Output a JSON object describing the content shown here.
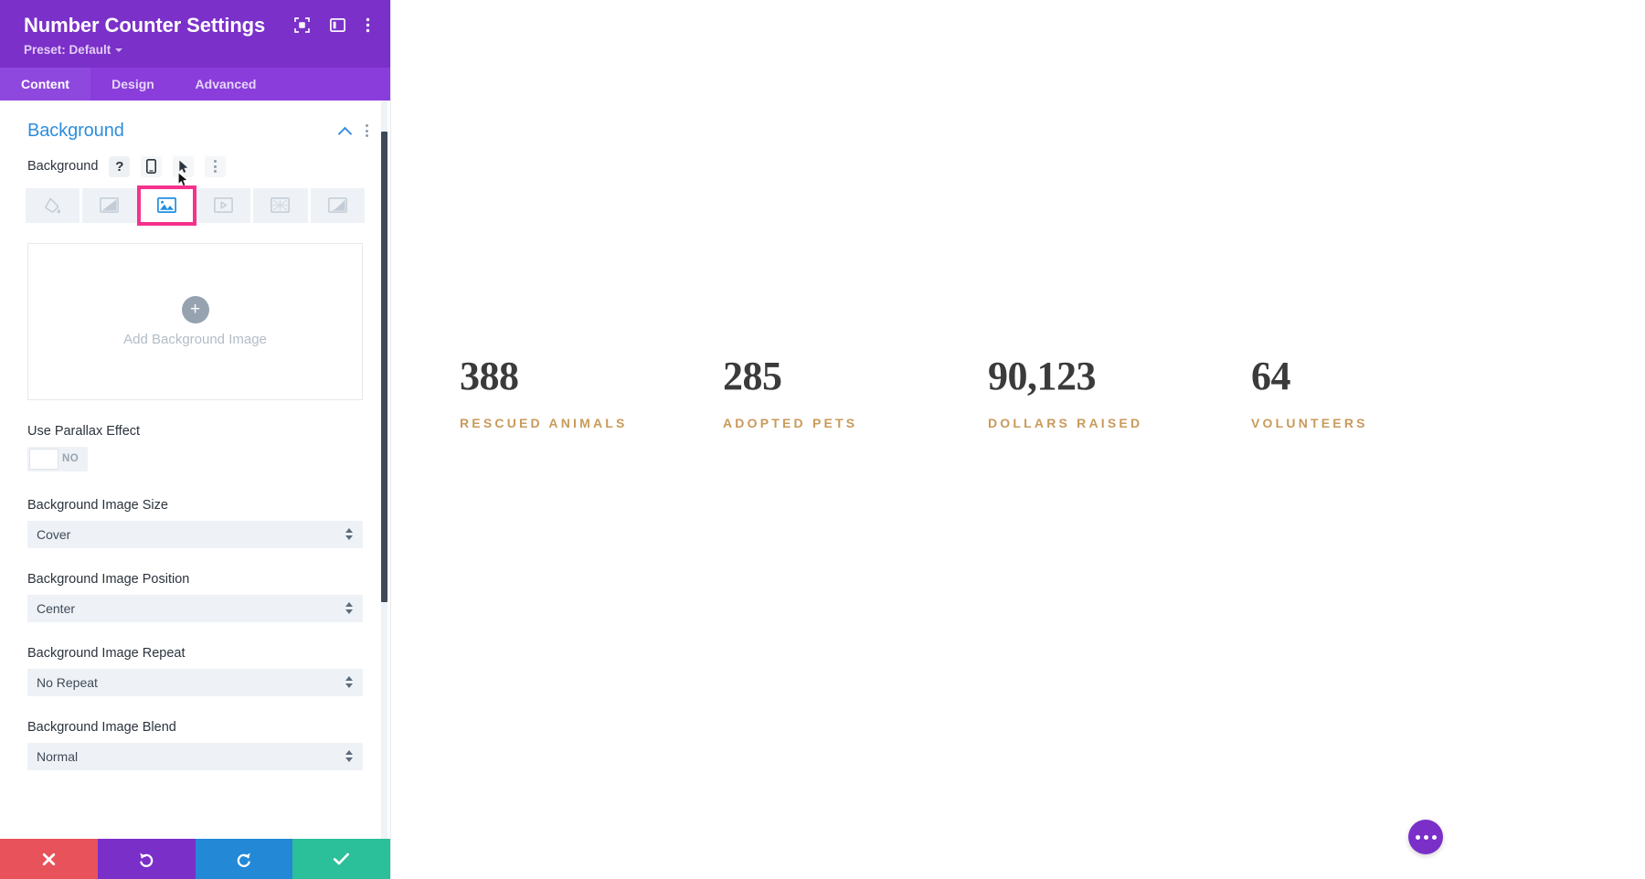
{
  "panel": {
    "title": "Number Counter Settings",
    "preset_label": "Preset: Default",
    "header_icons": [
      {
        "name": "focus-target-icon"
      },
      {
        "name": "layout-panel-icon"
      },
      {
        "name": "more-vertical-icon"
      }
    ],
    "tabs": [
      {
        "label": "Content",
        "active": true
      },
      {
        "label": "Design",
        "active": false
      },
      {
        "label": "Advanced",
        "active": false
      }
    ],
    "section": {
      "title": "Background",
      "collapse_icon": "chevron-up-icon",
      "options_icon": "more-vertical-icon"
    },
    "background_field": {
      "label": "Background",
      "help_icon": "question-mark-icon",
      "responsive_icon": "mobile-device-icon",
      "hover_icon": "cursor-pointer-icon",
      "options_icon": "more-vertical-icon"
    },
    "background_types": [
      {
        "name": "background-color-tab",
        "icon": "paint-bucket-icon",
        "selected": false
      },
      {
        "name": "background-gradient-tab",
        "icon": "gradient-icon",
        "selected": false
      },
      {
        "name": "background-image-tab",
        "icon": "image-icon",
        "selected": true
      },
      {
        "name": "background-video-tab",
        "icon": "video-icon",
        "selected": false
      },
      {
        "name": "background-pattern-tab",
        "icon": "pattern-icon",
        "selected": false
      },
      {
        "name": "background-mask-tab",
        "icon": "mask-icon",
        "selected": false
      }
    ],
    "upload": {
      "plus": "+",
      "label": "Add Background Image"
    },
    "parallax": {
      "label": "Use Parallax Effect",
      "value": "NO"
    },
    "fields": [
      {
        "label": "Background Image Size",
        "value": "Cover"
      },
      {
        "label": "Background Image Position",
        "value": "Center"
      },
      {
        "label": "Background Image Repeat",
        "value": "No Repeat"
      },
      {
        "label": "Background Image Blend",
        "value": "Normal"
      }
    ],
    "footer": [
      {
        "name": "cancel-button",
        "icon": "close-x-icon",
        "color": "#e8525a"
      },
      {
        "name": "undo-button",
        "icon": "undo-icon",
        "color": "#7b2fc9"
      },
      {
        "name": "redo-button",
        "icon": "redo-icon",
        "color": "#2388d6"
      },
      {
        "name": "save-button",
        "icon": "checkmark-icon",
        "color": "#2bbf9a"
      }
    ],
    "colors": {
      "header_purple": "#7b30c9",
      "tab_purple": "#8a3ddb",
      "section_blue": "#2e8ddd",
      "highlight_pink": "#f5328c"
    }
  },
  "canvas": {
    "counters": [
      {
        "number": "388",
        "label": "Rescued Animals"
      },
      {
        "number": "285",
        "label": "Adopted Pets"
      },
      {
        "number": "90,123",
        "label": "Dollars Raised"
      },
      {
        "number": "64",
        "label": "Volunteers"
      }
    ],
    "fab": {
      "name": "page-settings-fab",
      "icon": "more-horizontal-icon"
    },
    "label_color": "#c99a5b",
    "number_color": "#3b3b3b"
  }
}
